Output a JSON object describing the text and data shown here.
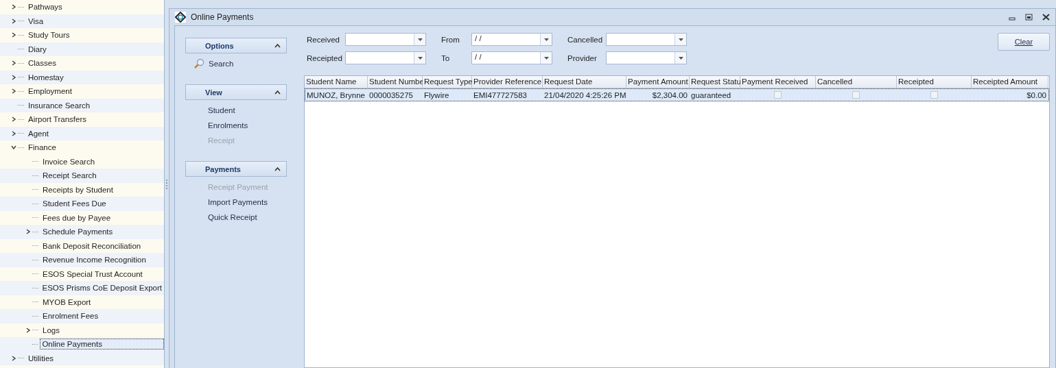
{
  "tree": [
    {
      "label": "Pathways",
      "expanded": false,
      "selected": false
    },
    {
      "label": "Visa",
      "expanded": false,
      "selected": false
    },
    {
      "label": "Study Tours",
      "expanded": false,
      "selected": false
    },
    {
      "label": "Diary",
      "selected": false
    },
    {
      "label": "Classes",
      "expanded": false,
      "selected": false
    },
    {
      "label": "Homestay",
      "expanded": false,
      "selected": false
    },
    {
      "label": "Employment",
      "expanded": false,
      "selected": false
    },
    {
      "label": "Insurance Search",
      "selected": false
    },
    {
      "label": "Airport Transfers",
      "expanded": false,
      "selected": false
    },
    {
      "label": "Agent",
      "expanded": false,
      "selected": false
    },
    {
      "label": "Finance",
      "expanded": true,
      "selected": false,
      "children": [
        {
          "label": "Invoice Search",
          "selected": false
        },
        {
          "label": "Receipt Search",
          "selected": false
        },
        {
          "label": "Receipts by Student",
          "selected": false
        },
        {
          "label": "Student Fees Due",
          "selected": false
        },
        {
          "label": "Fees due by Payee",
          "selected": false
        },
        {
          "label": "Schedule Payments",
          "expanded": false,
          "selected": false
        },
        {
          "label": "Bank Deposit Reconciliation",
          "selected": false
        },
        {
          "label": "Revenue Income Recognition",
          "selected": false
        },
        {
          "label": "ESOS Special Trust Account",
          "selected": false
        },
        {
          "label": "ESOS Prisms CoE Deposit Export",
          "selected": false
        },
        {
          "label": "MYOB Export",
          "selected": false
        },
        {
          "label": "Enrolment Fees",
          "selected": false
        },
        {
          "label": "Logs",
          "expanded": false,
          "selected": false
        },
        {
          "label": "Online Payments",
          "selected": true
        }
      ]
    },
    {
      "label": "Utilities",
      "expanded": false,
      "selected": false
    }
  ],
  "window": {
    "title": "Online Payments"
  },
  "nav_groups": [
    {
      "title": "Options",
      "expanded": true,
      "items": [
        {
          "label": "Search",
          "disabled": false,
          "kind": "search"
        }
      ]
    },
    {
      "title": "View",
      "expanded": true,
      "items": [
        {
          "label": "Student",
          "disabled": false,
          "kind": "link"
        },
        {
          "label": "Enrolments",
          "disabled": false,
          "kind": "link"
        },
        {
          "label": "Receipt",
          "disabled": true,
          "kind": "link"
        }
      ]
    },
    {
      "title": "Payments",
      "expanded": true,
      "items": [
        {
          "label": "Receipt Payment",
          "disabled": true,
          "kind": "link"
        },
        {
          "label": "Import Payments",
          "disabled": false,
          "kind": "link"
        },
        {
          "label": "Quick Receipt",
          "disabled": false,
          "kind": "link"
        }
      ]
    }
  ],
  "filters": [
    {
      "label": "Received"
    },
    {
      "label": "From",
      "value": "/ /"
    },
    {
      "label": "Cancelled"
    },
    {
      "label": "Receipted"
    },
    {
      "label": "To",
      "value": "/ /"
    },
    {
      "label": "Provider"
    }
  ],
  "clear_button": "Clear",
  "table": {
    "columns": [
      {
        "label": "Student Name",
        "kind": "text"
      },
      {
        "label": "Student Numbe",
        "kind": "text"
      },
      {
        "label": "Request Type",
        "kind": "text"
      },
      {
        "label": "Provider Reference",
        "kind": "text"
      },
      {
        "label": "Request Date",
        "kind": "text"
      },
      {
        "label": "Payment Amount",
        "kind": "number"
      },
      {
        "label": "Request Statu",
        "kind": "text"
      },
      {
        "label": "Payment Received",
        "kind": "check"
      },
      {
        "label": "Cancelled",
        "kind": "check"
      },
      {
        "label": "Receipted",
        "kind": "check"
      },
      {
        "label": "Receipted Amount",
        "kind": "number"
      }
    ],
    "rows": [
      {
        "selected": true,
        "cells": [
          "MUNOZ, Brynne",
          "0000035275",
          "Flywire",
          "EMI477727583",
          "21/04/2020 4:25:26 PM",
          "$2,304.00",
          "guaranteed",
          false,
          false,
          false,
          "$0.00"
        ]
      }
    ]
  }
}
